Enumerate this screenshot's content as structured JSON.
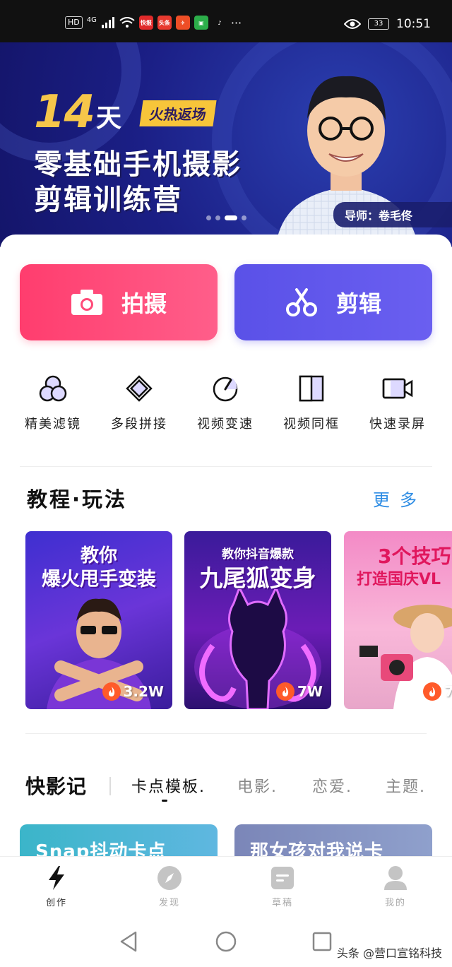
{
  "status_bar": {
    "left_tags": [
      "HD",
      "4G"
    ],
    "apps": [
      {
        "name": "kuaibao-app-icon",
        "label": "快报",
        "color": "#e02a2a"
      },
      {
        "name": "toutiao-app-icon",
        "label": "头条",
        "color": "#e83a2f"
      },
      {
        "name": "app3-icon",
        "label": "",
        "color": "#ee4e26"
      },
      {
        "name": "app4-icon",
        "label": "",
        "color": "#2cae4a"
      },
      {
        "name": "tiktok-app-icon",
        "label": "",
        "color": "#111111"
      }
    ],
    "more": "···",
    "battery": "33",
    "time": "10:51"
  },
  "banner": {
    "day_number": "14",
    "day_unit": "天",
    "hot_tag": "火热返场",
    "line1": "零基础手机摄影",
    "line2": "剪辑训练营",
    "mentor": "导师：卷毛佟",
    "dots_total": 4,
    "dots_active": 2
  },
  "actions": {
    "shoot_label": "拍摄",
    "edit_label": "剪辑"
  },
  "tools": [
    {
      "name": "filter",
      "label": "精美滤镜"
    },
    {
      "name": "splice",
      "label": "多段拼接"
    },
    {
      "name": "speed",
      "label": "视频变速"
    },
    {
      "name": "split-frame",
      "label": "视频同框"
    },
    {
      "name": "screen-record",
      "label": "快速录屏"
    }
  ],
  "tutorials": {
    "title": "教程·玩法",
    "more": "更多",
    "cards": [
      {
        "title_top": "教你",
        "title_bottom": "爆火甩手变装",
        "count": "3.2W"
      },
      {
        "title_top": "教你抖音爆款",
        "title_bottom": "九尾狐变身",
        "count": "7W"
      },
      {
        "title_top": "3个技巧",
        "title_bottom": "打造国庆VL",
        "count": "7"
      }
    ]
  },
  "kuaiyingji": {
    "brand": "快影记",
    "tabs": [
      "卡点模板.",
      "电影.",
      "恋爱.",
      "主题."
    ],
    "active_tab": 0,
    "templates": [
      "Snap抖动卡点",
      "那女孩对我说卡"
    ]
  },
  "bottom_nav": {
    "items": [
      "创作",
      "发现",
      "草稿",
      "我的"
    ],
    "active": 0
  },
  "watermark": "头条 @营口宣铭科技"
}
